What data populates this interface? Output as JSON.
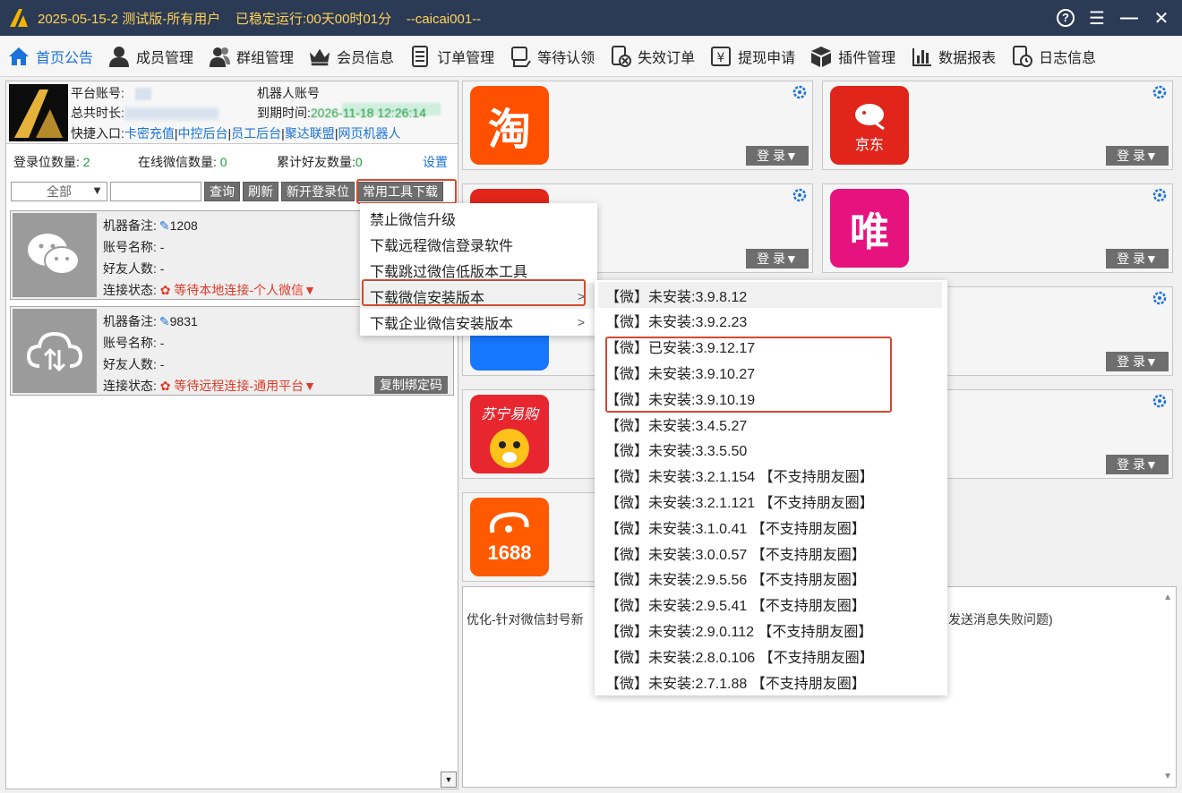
{
  "titlebar": {
    "title": "2025-05-15-2 测试版-所有用户    已稳定运行:00天00时01分    --caicai001--",
    "help_glyph": "?",
    "menu_glyph": "☰",
    "minimize_glyph": "—",
    "close_glyph": "✕"
  },
  "nav": [
    {
      "label": "首页公告",
      "icon": "home-icon"
    },
    {
      "label": "成员管理",
      "icon": "user-icon"
    },
    {
      "label": "群组管理",
      "icon": "group-icon"
    },
    {
      "label": "会员信息",
      "icon": "crown-icon"
    },
    {
      "label": "订单管理",
      "icon": "list-icon"
    },
    {
      "label": "等待认领",
      "icon": "hand-icon"
    },
    {
      "label": "失效订单",
      "icon": "invalid-order-icon"
    },
    {
      "label": "提现申请",
      "icon": "withdraw-icon"
    },
    {
      "label": "插件管理",
      "icon": "cube-icon"
    },
    {
      "label": "数据报表",
      "icon": "bar-chart-icon"
    },
    {
      "label": "日志信息",
      "icon": "log-icon"
    }
  ],
  "account": {
    "platform_label": "平台账号:",
    "robot_label": "机器人账号",
    "total_time_label": "总共时长:",
    "total_time_value": "9999天小时59分",
    "expire_label": "到期时间:",
    "expire_value": "2026-11-18 12:26:14",
    "quick_label": "快捷入口:",
    "quick_links": [
      "卡密充值",
      "中控后台",
      "员工后台",
      "聚达联盟",
      "网页机器人"
    ],
    "sep": "|"
  },
  "stats": {
    "login_slots_label": "登录位数量:",
    "login_slots": "2",
    "online_label": "在线微信数量:",
    "online": "0",
    "friends_label": "累计好友数量:",
    "friends": "0",
    "settings": "设置"
  },
  "toolbar": {
    "filter": "全部",
    "filter_arrow": "▼",
    "query": "查询",
    "refresh": "刷新",
    "new_slot": "新开登录位",
    "tools": "常用工具下载"
  },
  "cards": [
    {
      "remark_label": "机器备注:",
      "remark": "1208",
      "account_label": "账号名称:",
      "account": "-",
      "friends_label": "好友人数:",
      "friends": "-",
      "status_label": "连接状态:",
      "status": "等待本地连接-个人微信",
      "status_arrow": "▼",
      "avatar_icon": "wechat-icon"
    },
    {
      "remark_label": "机器备注:",
      "remark": "9831",
      "account_label": "账号名称:",
      "account": "-",
      "friends_label": "好友人数:",
      "friends": "-",
      "status_label": "连接状态:",
      "status": "等待远程连接-通用平台",
      "status_arrow": "▼",
      "copy": "复制绑定码",
      "avatar_icon": "cloud-icon"
    }
  ],
  "apps": [
    {
      "name": "淘",
      "login": "登 录▼",
      "color": "#ff5000"
    },
    {
      "name": "京东",
      "login": "登 录▼",
      "color": "#e1251b"
    },
    {
      "name": "",
      "login": "登 录▼",
      "color": "#e1251b"
    },
    {
      "name": "唯",
      "login": "登 录▼",
      "color": "#e6137e"
    },
    {
      "name": "",
      "login": "",
      "color": "#1677ff"
    },
    {
      "name": "",
      "login": "登 录▼",
      "color": "#f5f5f5"
    },
    {
      "name": "苏宁易购",
      "login": "",
      "color": "#e8262f"
    },
    {
      "name": "",
      "login": "登 录▼",
      "color": "#f5f5f5"
    },
    {
      "name": "1688",
      "login": "",
      "color": "#ff5a00"
    }
  ],
  "notice": {
    "left": "优化-针对微信封号新",
    "right": "发送消息失败问题)"
  },
  "tool_menu": [
    {
      "label": "禁止微信升级",
      "sub": false
    },
    {
      "label": "下载远程微信登录软件",
      "sub": false
    },
    {
      "label": "下载跳过微信低版本工具",
      "sub": false
    },
    {
      "label": "下载微信安装版本",
      "sub": true
    },
    {
      "label": "下载企业微信安装版本",
      "sub": true
    }
  ],
  "submenu_arrow": ">",
  "version_menu": [
    "【微】未安装:3.9.8.12",
    "【微】未安装:3.9.2.23",
    "【微】已安装:3.9.12.17",
    "【微】未安装:3.9.10.27",
    "【微】未安装:3.9.10.19",
    "【微】未安装:3.4.5.27",
    "【微】未安装:3.3.5.50",
    "【微】未安装:3.2.1.154 【不支持朋友圈】",
    "【微】未安装:3.2.1.121 【不支持朋友圈】",
    "【微】未安装:3.1.0.41 【不支持朋友圈】",
    "【微】未安装:3.0.0.57 【不支持朋友圈】",
    "【微】未安装:2.9.5.56 【不支持朋友圈】",
    "【微】未安装:2.9.5.41 【不支持朋友圈】",
    "【微】未安装:2.9.0.112 【不支持朋友圈】",
    "【微】未安装:2.8.0.106 【不支持朋友圈】",
    "【微】未安装:2.7.1.88 【不支持朋友圈】"
  ]
}
